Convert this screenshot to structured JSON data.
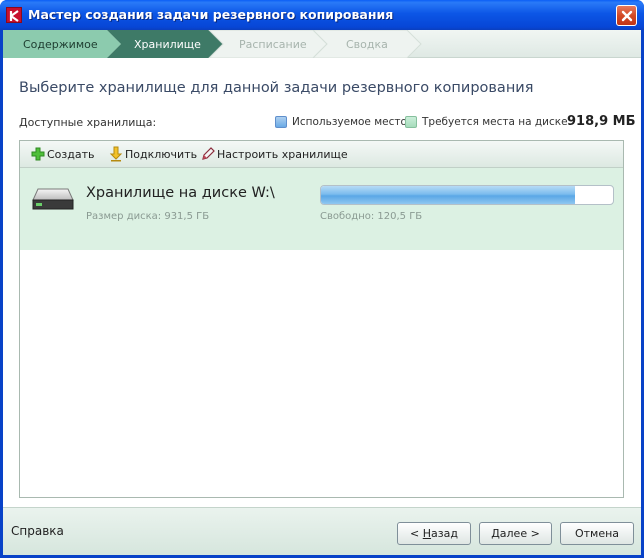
{
  "window": {
    "title": "Мастер создания задачи резервного копирования"
  },
  "steps": [
    {
      "label": "Содержимое",
      "state": "done"
    },
    {
      "label": "Хранилище",
      "state": "active"
    },
    {
      "label": "Расписание",
      "state": "pending"
    },
    {
      "label": "Сводка",
      "state": "pending"
    }
  ],
  "heading": "Выберите хранилище для данной задачи резервного копирования",
  "available": {
    "label": "Доступные хранилища:",
    "legend_used": "Используемое место",
    "legend_required": "Требуется места на диске:",
    "required_value": "918,9 МБ"
  },
  "toolbar": {
    "create": "Создать",
    "connect": "Подключить",
    "configure": "Настроить хранилище"
  },
  "storage": {
    "name": "Хранилище на диске W:\\",
    "size": "Размер диска: 931,5 ГБ",
    "free": "Свободно: 120,5 ГБ",
    "used_fraction": 0.871
  },
  "footer": {
    "help": "Справка",
    "back_underline": "Н",
    "back_rest": "азад",
    "back_prefix": "< ",
    "next_underline": "Д",
    "next_rest": "алее >",
    "cancel": "Отмена"
  },
  "colors": {
    "step_done": "#8ccbae",
    "step_active": "#3e7a67",
    "step_pending": "#eef3f0",
    "selected_row": "#dcf1e3"
  },
  "icons": {
    "app": "kaspersky-k-icon",
    "close": "close-x-icon",
    "create": "green-plus-icon",
    "connect": "yellow-arrow-down-icon",
    "configure": "pencil-icon",
    "drive": "hard-drive-icon"
  }
}
